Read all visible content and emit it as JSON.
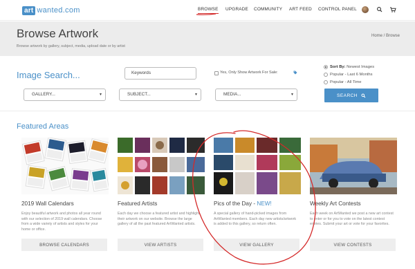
{
  "nav": {
    "logo_mark": "art",
    "logo_text": "wanted.com",
    "items": [
      "BROWSE",
      "UPGRADE",
      "COMMUNITY",
      "ART FEED",
      "CONTROL PANEL"
    ],
    "active": "BROWSE",
    "icons": [
      "avatar",
      "search-icon",
      "cart-icon"
    ]
  },
  "hero": {
    "title": "Browse Artwork",
    "subtitle": "Browse artwork by gallery, subject, media, upload date or by artist",
    "breadcrumb": "Home / Browse"
  },
  "search": {
    "title": "Image Search...",
    "keywords_placeholder": "Keywords",
    "sale_label": "Yes, Only Show Artwork For Sale:",
    "selects": [
      "GALLERY...",
      "SUBJECT...",
      "MEDIA..."
    ],
    "sort_label": "Sort By:",
    "sort_options": [
      "Newest Images",
      "Popular - Last 6 Months",
      "Popular - All Time"
    ],
    "sort_selected": 0,
    "button": "SEARCH"
  },
  "featured": {
    "title": "Featured Areas",
    "cards": [
      {
        "title": "2019 Wall Calendars",
        "desc": "Enjoy beautiful artwork and photos all year round with our selection of 2019 wall calendars. Choose from a wide variety of artists and styles for your home or office.",
        "button": "BROWSE CALENDARS"
      },
      {
        "title": "Featured Artists",
        "desc": "Each day we choose a featured artist and highlight their artwork on our website. Browse the large gallery of all the past featured ArtWanted artists.",
        "button": "VIEW ARTISTS"
      },
      {
        "title": "Pics of the Day - ",
        "title_badge": "NEW!",
        "desc": "A special gallery of hand-picked images from ArtWanted members. Each day new artists/artwork is added to this gallery, so return often.",
        "button": "VIEW GALLERY"
      },
      {
        "title": "Weekly Art Contests",
        "desc": "Each week on ArtWanted we post a new art contest to enter or for you to vote on the latest contest entries. Submit your art or vote for your favorites.",
        "button": "VIEW CONTESTS"
      }
    ]
  },
  "colors": {
    "accent": "#4a90c8",
    "nav_underline": "#d43030",
    "annotation": "#d42a2a"
  }
}
